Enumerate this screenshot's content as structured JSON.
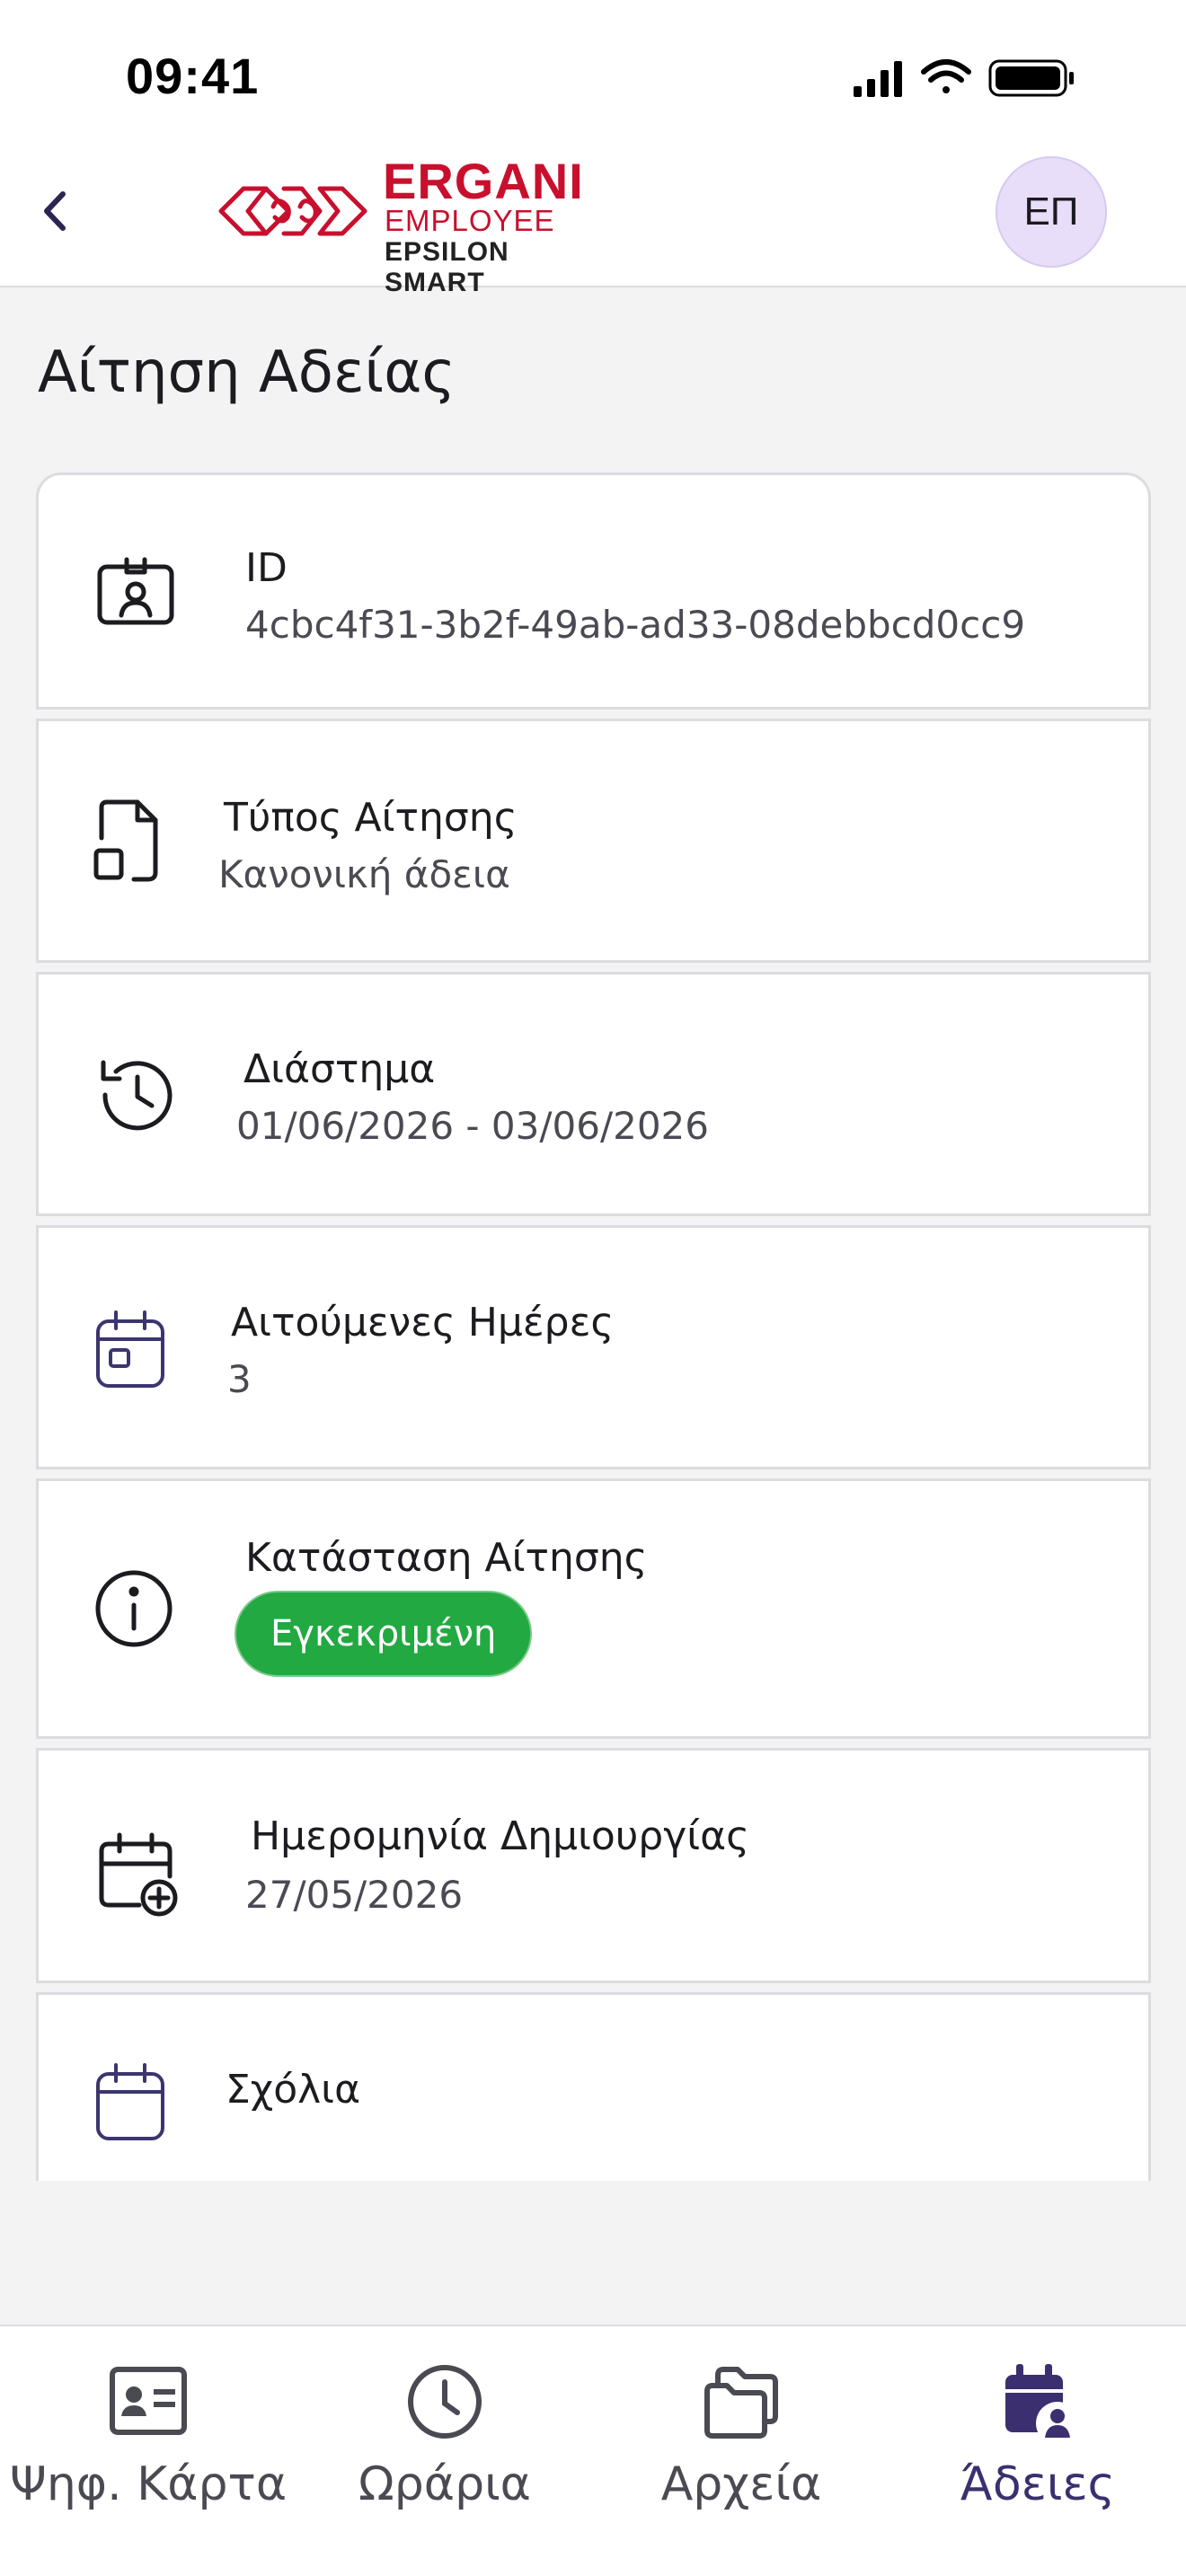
{
  "status": {
    "time": "09:41"
  },
  "header": {
    "logo": {
      "line1": "ERGANI",
      "line2": "EMPLOYEE",
      "line3": "EPSILON SMART"
    },
    "avatar_initials": "ΕΠ"
  },
  "page": {
    "title": "Αίτηση Αδείας"
  },
  "details": {
    "id": {
      "label": "ID",
      "value": "4cbc4f31-3b2f-49ab-ad33-08debbcd0cc9",
      "icon": "id-badge-icon"
    },
    "type": {
      "label": "Τύπος Αίτησης",
      "value": "Κανονική άδεια",
      "icon": "document-icon"
    },
    "period": {
      "label": "Διάστημα",
      "value": "01/06/2026 - 03/06/2026",
      "icon": "history-icon"
    },
    "days": {
      "label": "Αιτούμενες Ημέρες",
      "value": "3",
      "icon": "calendar-icon"
    },
    "status": {
      "label": "Κατάσταση Αίτησης",
      "value": "Εγκεκριμένη",
      "icon": "info-icon",
      "color": "#22a941"
    },
    "created": {
      "label": "Ημερομηνία Δημιουργίας",
      "value": "27/05/2026",
      "icon": "calendar-add-icon"
    },
    "comments": {
      "label": "Σχόλια",
      "icon": "calendar-icon"
    }
  },
  "bottom_nav": {
    "items": [
      {
        "label": "Ψηφ. Κάρτα",
        "icon": "id-card-icon"
      },
      {
        "label": "Ωράρια",
        "icon": "clock-icon"
      },
      {
        "label": "Αρχεία",
        "icon": "folders-icon"
      },
      {
        "label": "Άδειες",
        "icon": "calendar-user-icon",
        "active": true
      }
    ],
    "active_color": "#3b2f6f"
  }
}
